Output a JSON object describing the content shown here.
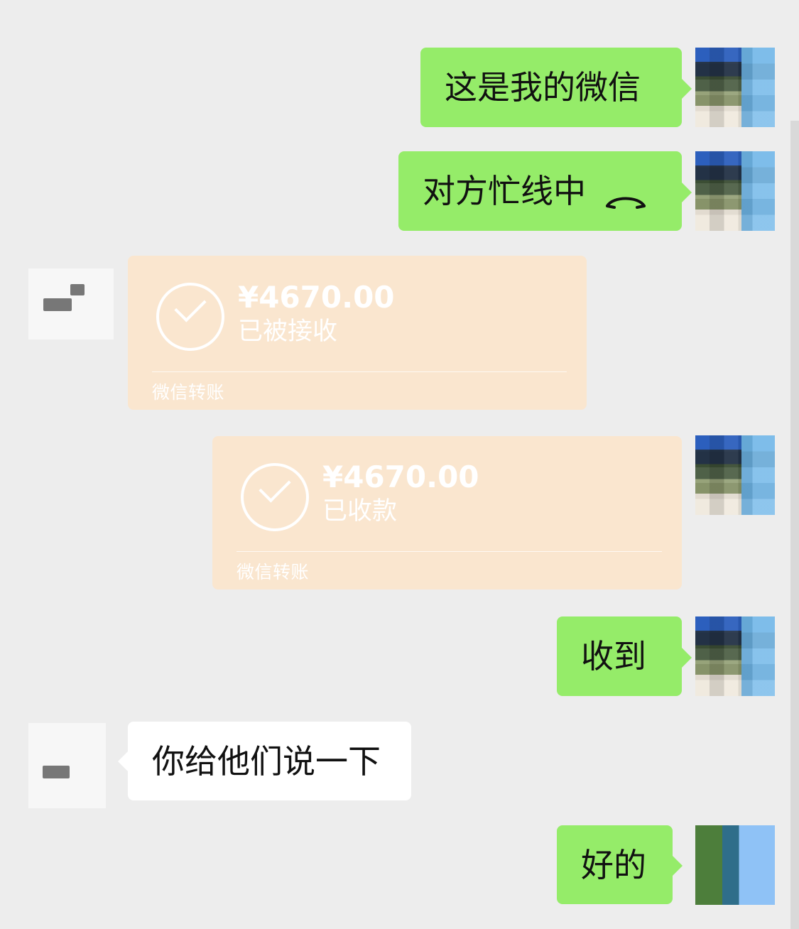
{
  "messages": [
    {
      "from": "self",
      "text": "这是我的微信"
    },
    {
      "from": "self",
      "text": "对方忙线中"
    },
    {
      "from": "other",
      "transfer": {
        "amount": "¥4670.00",
        "status": "已被接收",
        "label": "微信转账"
      }
    },
    {
      "from": "self",
      "transfer": {
        "amount": "¥4670.00",
        "status": "已收款",
        "label": "微信转账"
      }
    },
    {
      "from": "self",
      "text": "收到"
    },
    {
      "from": "other",
      "text": "你给他们说一下"
    },
    {
      "from": "self",
      "text": "好的"
    }
  ],
  "icons": {
    "call": "phone-hangup-icon",
    "transfer": "check-circle-icon"
  },
  "colors": {
    "background": "#ededed",
    "self_bubble": "#95ec69",
    "other_bubble": "#ffffff",
    "transfer_card": "#fae6cf"
  }
}
